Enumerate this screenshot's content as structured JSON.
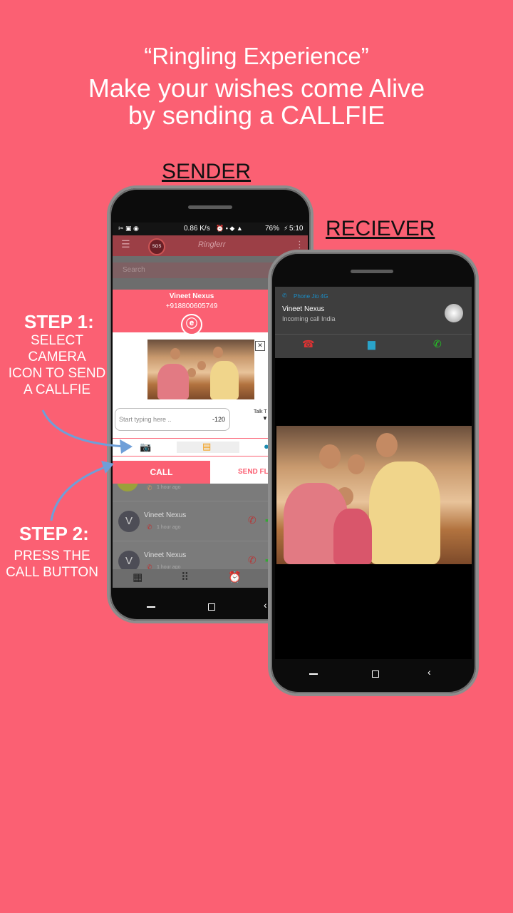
{
  "header": {
    "line1": "“Ringling Experience”",
    "line2": "Make your wishes come Alive",
    "line3": "by sending a CALLFIE"
  },
  "labels": {
    "sender": "SENDER",
    "receiver": "RECIEVER"
  },
  "steps": [
    {
      "title": "STEP 1:",
      "lines": [
        "SELECT",
        "CAMERA",
        "ICON TO SEND",
        "A CALLFIE"
      ]
    },
    {
      "title": "STEP 2:",
      "lines": [
        "PRESS THE",
        "CALL BUTTON"
      ]
    }
  ],
  "sender_phone": {
    "status": {
      "speed": "0.86 K/s",
      "battery": "76%",
      "time": "5:10"
    },
    "app_title": "Ringlerr",
    "app_badge": "SOS",
    "search_placeholder": "Search",
    "dialog": {
      "contact_name": "Vineet Nexus",
      "contact_number": "+918800605749",
      "message_placeholder": "Start typing here ..",
      "char_count": "-120",
      "talk_label": "Talk T",
      "call_button": "CALL",
      "send_button": "SEND FL"
    },
    "contacts": [
      {
        "initial": "V",
        "name": "Vineet Nexus",
        "time": "1 hour ago"
      },
      {
        "initial": "V",
        "name": "Vineet Nexus",
        "time": "1 hour ago"
      }
    ],
    "partial_time": "1 hour ago"
  },
  "receiver_phone": {
    "notification": {
      "source": "Phone Jio 4G",
      "caller": "Vineet Nexus",
      "subtitle": "Incoming call India"
    }
  },
  "colors": {
    "background": "#fb6073",
    "accent": "#fb6073",
    "arrow": "#6f9fd8"
  }
}
